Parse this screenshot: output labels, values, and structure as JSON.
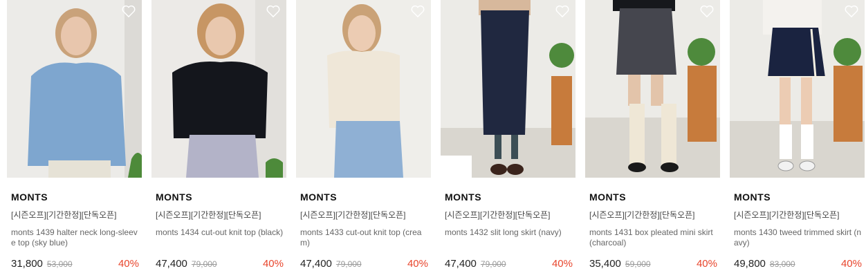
{
  "colors": {
    "discount": "#e8452c",
    "price": "#222222",
    "original_price": "#999999"
  },
  "products": [
    {
      "brand": "MONTS",
      "tags": "[시즌오프][기간한정][단독오픈]",
      "name": "monts 1439 halter neck long-sleeve top (sky blue)",
      "price": "31,800",
      "original_price": "53,000",
      "discount": "40%",
      "icon": "heart-icon"
    },
    {
      "brand": "MONTS",
      "tags": "[시즌오프][기간한정][단독오픈]",
      "name": "monts 1434 cut-out knit top (black)",
      "price": "47,400",
      "original_price": "79,000",
      "discount": "40%",
      "icon": "heart-icon"
    },
    {
      "brand": "MONTS",
      "tags": "[시즌오프][기간한정][단독오픈]",
      "name": "monts 1433 cut-out knit top (cream)",
      "price": "47,400",
      "original_price": "79,000",
      "discount": "40%",
      "icon": "heart-icon"
    },
    {
      "brand": "MONTS",
      "tags": "[시즌오프][기간한정][단독오픈]",
      "name": "monts 1432 slit long skirt (navy)",
      "price": "47,400",
      "original_price": "79,000",
      "discount": "40%",
      "icon": "heart-icon"
    },
    {
      "brand": "MONTS",
      "tags": "[시즌오프][기간한정][단독오픈]",
      "name": "monts 1431 box pleated mini skirt (charcoal)",
      "price": "35,400",
      "original_price": "59,000",
      "discount": "40%",
      "icon": "heart-icon"
    },
    {
      "brand": "MONTS",
      "tags": "[시즌오프][기간한정][단독오픈]",
      "name": "monts 1430 tweed trimmed skirt (navy)",
      "price": "49,800",
      "original_price": "83,000",
      "discount": "40%",
      "icon": "heart-icon"
    }
  ]
}
